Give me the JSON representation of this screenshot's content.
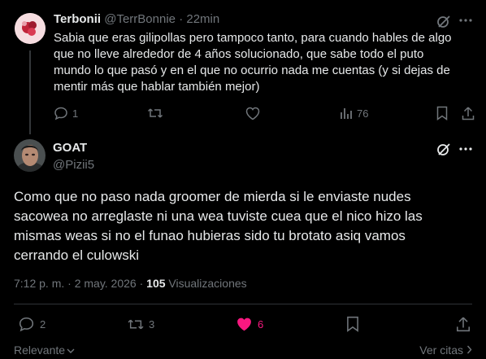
{
  "reply": {
    "name": "Terbonii",
    "handle": "@TerrBonnie",
    "separator": "·",
    "time": "22min",
    "text": "Sabia que eras gilipollas pero tampoco tanto, para cuando hables de algo que no lleve alrededor de 4 años solucionado, que sabe todo el puto mundo lo que pasó y en el que no ocurrio nada me cuentas (y si dejas de mentir más que hablar también mejor)",
    "reply_count": "1",
    "views": "76"
  },
  "main": {
    "name": "GOAT",
    "handle": "@Pizii5",
    "text": "Como que no paso nada groomer de mierda si le enviaste nudes sacowea  no arreglaste ni una wea tuviste cuea que el nico hizo las mismas weas si no el funao hubieras sido tu brotato asiq vamos cerrando el culowski",
    "timestamp": "7:12 p. m. · 2 may. 2026 ·",
    "views_count": "105",
    "views_label": "Visualizaciones",
    "reply_count": "2",
    "repost_count": "3",
    "like_count": "6"
  },
  "footer": {
    "sort_label": "Relevante",
    "quotes_label": "Ver citas"
  },
  "colors": {
    "background": "#000000",
    "text": "#e7e9ea",
    "muted": "#71767b",
    "like": "#f91880",
    "divider": "#2f3336"
  }
}
